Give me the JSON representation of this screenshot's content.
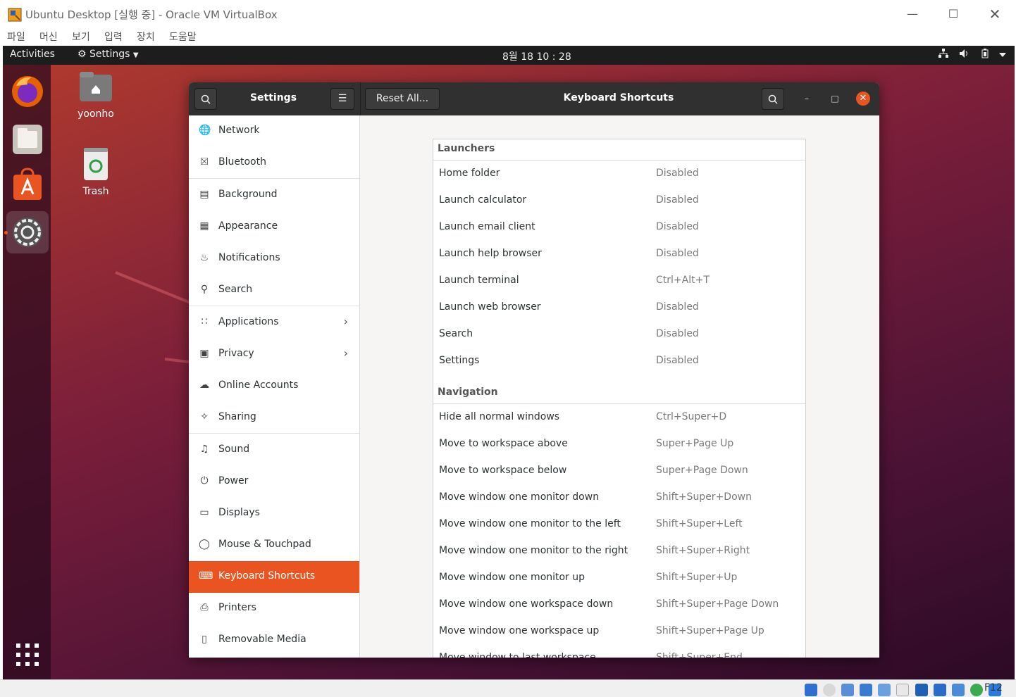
{
  "vbox": {
    "title": "Ubuntu Desktop [실행 중] - Oracle VM VirtualBox",
    "menu": [
      "파일",
      "머신",
      "보기",
      "입력",
      "장치",
      "도움말"
    ],
    "host_key": "F12"
  },
  "topbar": {
    "activities": "Activities",
    "app_menu": "Settings",
    "clock": "8월 18  10 : 28"
  },
  "desktop_icons": [
    {
      "label": "yoonho",
      "icon": "home-folder-icon"
    },
    {
      "label": "Trash",
      "icon": "trash-icon"
    }
  ],
  "dock": [
    {
      "name": "firefox-icon"
    },
    {
      "name": "files-icon"
    },
    {
      "name": "software-icon"
    },
    {
      "name": "settings-icon",
      "active": true
    },
    {
      "name": "show-apps-icon"
    }
  ],
  "window": {
    "sidebar_title": "Settings",
    "reset_label": "Reset All...",
    "page_title": "Keyboard Shortcuts"
  },
  "sidebar": {
    "items": [
      {
        "label": "Network",
        "icon": "network-icon"
      },
      {
        "label": "Bluetooth",
        "icon": "bluetooth-icon"
      },
      {
        "label": "Background",
        "icon": "background-icon"
      },
      {
        "label": "Appearance",
        "icon": "appearance-icon"
      },
      {
        "label": "Notifications",
        "icon": "bell-icon"
      },
      {
        "label": "Search",
        "icon": "search-icon"
      },
      {
        "label": "Applications",
        "icon": "grid-icon",
        "submenu": true
      },
      {
        "label": "Privacy",
        "icon": "lock-icon",
        "submenu": true
      },
      {
        "label": "Online Accounts",
        "icon": "cloud-icon"
      },
      {
        "label": "Sharing",
        "icon": "share-icon"
      },
      {
        "label": "Sound",
        "icon": "music-note-icon"
      },
      {
        "label": "Power",
        "icon": "power-icon"
      },
      {
        "label": "Displays",
        "icon": "display-icon"
      },
      {
        "label": "Mouse & Touchpad",
        "icon": "mouse-icon"
      },
      {
        "label": "Keyboard Shortcuts",
        "icon": "keyboard-icon",
        "active": true
      },
      {
        "label": "Printers",
        "icon": "printer-icon"
      },
      {
        "label": "Removable Media",
        "icon": "usb-icon"
      }
    ]
  },
  "shortcuts": {
    "launchers": {
      "title": "Launchers",
      "rows": [
        {
          "name": "Home folder",
          "accel": "Disabled"
        },
        {
          "name": "Launch calculator",
          "accel": "Disabled"
        },
        {
          "name": "Launch email client",
          "accel": "Disabled"
        },
        {
          "name": "Launch help browser",
          "accel": "Disabled"
        },
        {
          "name": "Launch terminal",
          "accel": "Ctrl+Alt+T"
        },
        {
          "name": "Launch web browser",
          "accel": "Disabled"
        },
        {
          "name": "Search",
          "accel": "Disabled"
        },
        {
          "name": "Settings",
          "accel": "Disabled"
        }
      ]
    },
    "navigation": {
      "title": "Navigation",
      "rows": [
        {
          "name": "Hide all normal windows",
          "accel": "Ctrl+Super+D"
        },
        {
          "name": "Move to workspace above",
          "accel": "Super+Page Up"
        },
        {
          "name": "Move to workspace below",
          "accel": "Super+Page Down"
        },
        {
          "name": "Move window one monitor down",
          "accel": "Shift+Super+Down"
        },
        {
          "name": "Move window one monitor to the left",
          "accel": "Shift+Super+Left"
        },
        {
          "name": "Move window one monitor to the right",
          "accel": "Shift+Super+Right"
        },
        {
          "name": "Move window one monitor up",
          "accel": "Shift+Super+Up"
        },
        {
          "name": "Move window one workspace down",
          "accel": "Shift+Super+Page Down"
        },
        {
          "name": "Move window one workspace up",
          "accel": "Shift+Super+Page Up"
        },
        {
          "name": "Move window to last workspace",
          "accel": "Shift+Super+End"
        }
      ]
    }
  },
  "colors": {
    "accent": "#e95420",
    "header": "#303030",
    "topbar": "#1d1d1d"
  }
}
